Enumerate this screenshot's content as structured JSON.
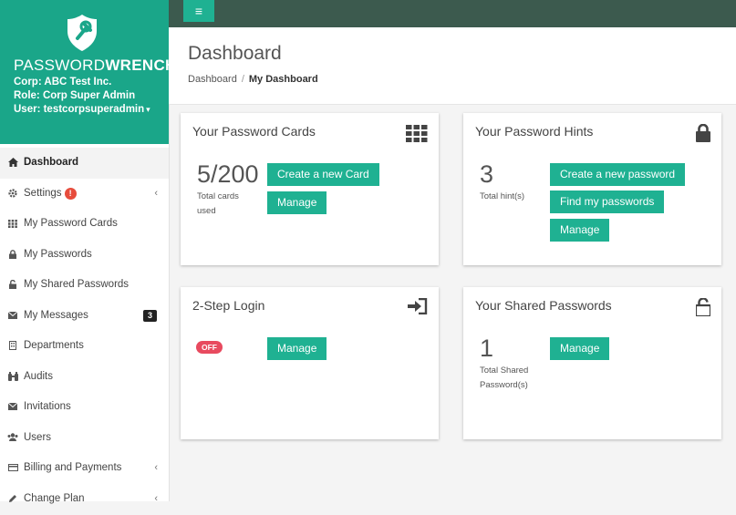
{
  "brand": {
    "name_light": "PASSWORD",
    "name_bold": "WRENCH",
    "corp": "Corp: ABC Test Inc.",
    "role": "Role: Corp Super Admin",
    "user": "User: testcorpsuperadmin",
    "user_caret": "▾",
    "accent_color": "#1aa689"
  },
  "sidebar": {
    "items": [
      {
        "label": "Dashboard",
        "icon": "home-icon"
      },
      {
        "label": "Settings",
        "icon": "gear-icon",
        "alert": "!"
      },
      {
        "label": "My Password Cards",
        "icon": "grid-icon"
      },
      {
        "label": "My Passwords",
        "icon": "lock-icon"
      },
      {
        "label": "My Shared Passwords",
        "icon": "unlock-icon"
      },
      {
        "label": "My Messages",
        "icon": "envelope-icon",
        "badge": "3"
      },
      {
        "label": "Departments",
        "icon": "building-icon"
      },
      {
        "label": "Audits",
        "icon": "binoculars-icon"
      },
      {
        "label": "Invitations",
        "icon": "envelope-icon"
      },
      {
        "label": "Users",
        "icon": "users-icon"
      },
      {
        "label": "Billing and Payments",
        "icon": "credit-card-icon"
      },
      {
        "label": "Change Plan",
        "icon": "pencil-icon"
      }
    ],
    "chevron": "‹"
  },
  "topbar": {
    "toggle_glyph": "≡",
    "bg_color": "#3c5a4e"
  },
  "header": {
    "title": "Dashboard",
    "breadcrumb": {
      "root": "Dashboard",
      "sep": "/",
      "current": "My Dashboard"
    }
  },
  "cards": {
    "password_cards": {
      "title": "Your Password Cards",
      "count": "5/200",
      "caption_1": "Total cards",
      "caption_2": "used",
      "create_label": "Create a new Card",
      "manage_label": "Manage"
    },
    "password_hints": {
      "title": "Your Password Hints",
      "count": "3",
      "caption": "Total hint(s)",
      "create_label": "Create a new password",
      "find_label": "Find my passwords",
      "manage_label": "Manage"
    },
    "two_step": {
      "title": "2-Step Login",
      "status": "OFF",
      "manage_label": "Manage"
    },
    "shared_passwords": {
      "title": "Your Shared Passwords",
      "count": "1",
      "caption_1": "Total Shared",
      "caption_2": "Password(s)",
      "manage_label": "Manage"
    }
  },
  "colors": {
    "button": "#1fb192",
    "off_badge": "#e84a5f"
  }
}
